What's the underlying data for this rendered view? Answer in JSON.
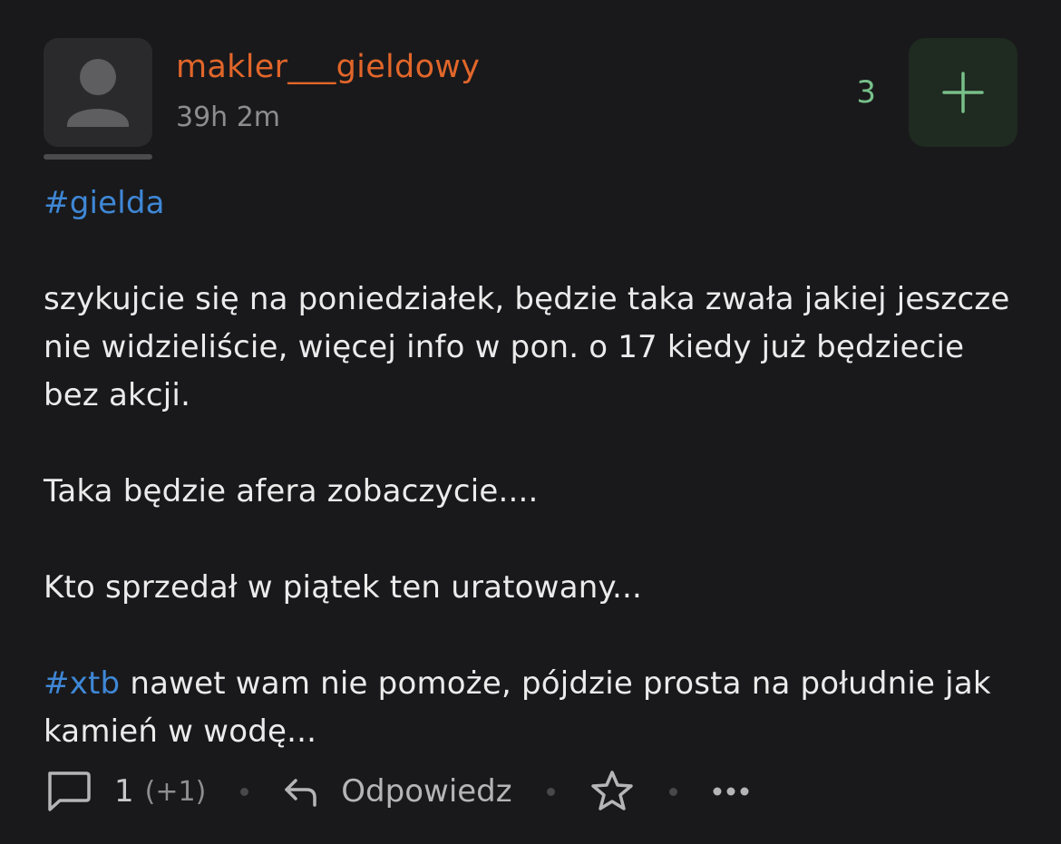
{
  "post": {
    "author": "makler___gieldowy",
    "time": "39h 2m",
    "votes": "3",
    "content": {
      "tag1": "#gielda",
      "para1": "szykujcie się na poniedziałek, będzie taka zwała jakiej jeszcze nie widzieliście, więcej info w pon. o 17 kiedy już będziecie bez akcji.",
      "para2": "Taka będzie afera zobaczycie....",
      "para3": "Kto sprzedał w piątek ten uratowany...",
      "tag2": "#xtb",
      "para4_rest": " nawet wam nie pomoże, pójdzie prosta na południe jak kamień w wodę..."
    }
  },
  "actions": {
    "comments_count": "1",
    "comments_delta": "(+1)",
    "reply_label": "Odpowiedz"
  },
  "icons": {
    "avatar": "user-avatar-icon",
    "plus": "plus-icon",
    "comment": "comment-icon",
    "reply": "reply-arrow-icon",
    "favorite": "star-icon",
    "more": "more-dots-icon"
  },
  "colors": {
    "background": "#19191b",
    "author": "#e2662a",
    "tag": "#3f87d6",
    "vote": "#78c08a",
    "text": "#ebebeb"
  }
}
